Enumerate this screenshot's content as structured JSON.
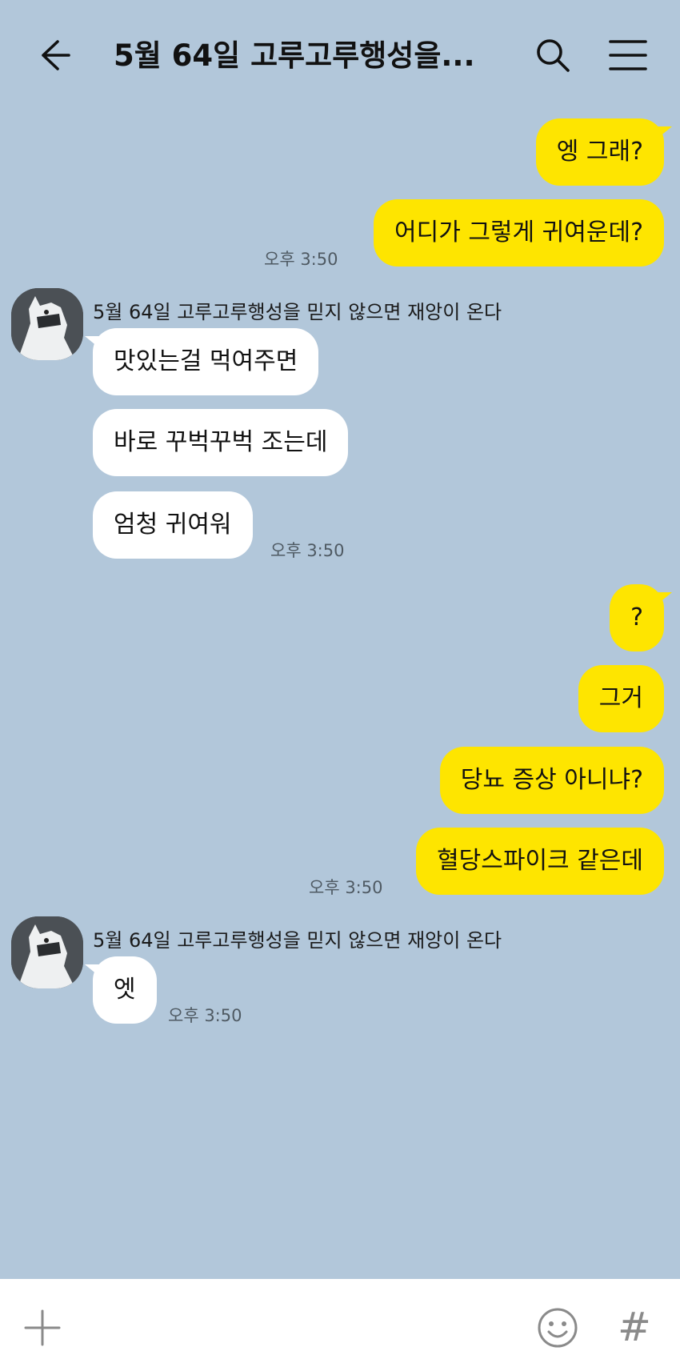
{
  "header": {
    "title": "5월 64일 고루고루행성을...",
    "icons": {
      "back": "arrow-left-icon",
      "search": "search-icon",
      "menu": "hamburger-menu-icon"
    }
  },
  "colors": {
    "background": "#b2c7da",
    "my_bubble": "#fee500",
    "other_bubble": "#ffffff"
  },
  "messages": {
    "m1": "엥 그래?",
    "m2": "어디가 그렇게 귀여운데?",
    "t1": "오후 3:50",
    "sender1": "5월 64일 고루고루행성을 믿지 않으면 재앙이 온다",
    "m3": "맛있는걸 먹여주면",
    "m4": "바로 꾸벅꾸벅 조는데",
    "m5": "엄청 귀여워",
    "t2": "오후 3:50",
    "m6": "?",
    "m7": "그거",
    "m8": "당뇨 증상 아니냐?",
    "m9": "혈당스파이크 같은데",
    "t3": "오후 3:50",
    "sender2": "5월 64일 고루고루행성을 믿지 않으면 재앙이 온다",
    "m10": "엣",
    "t4": "오후 3:50"
  },
  "input_bar": {
    "hash_glyph": "#",
    "icons": {
      "plus": "plus-icon",
      "emoji": "emoji-icon",
      "hash": "hashtag-icon"
    }
  }
}
